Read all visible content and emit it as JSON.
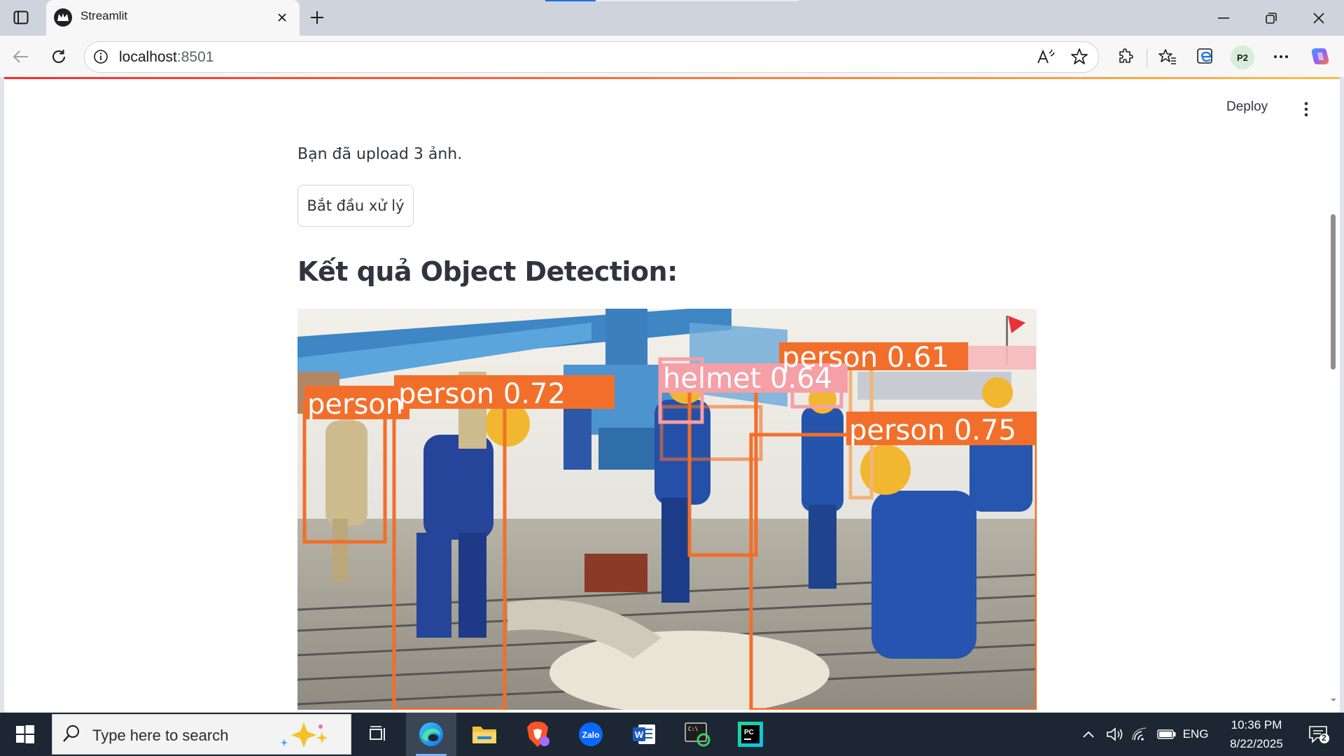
{
  "browser": {
    "tab_title": "Streamlit",
    "url_host": "localhost",
    "url_port": ":8501",
    "profile_label": "P2"
  },
  "app": {
    "deploy_label": "Deploy",
    "upload_info": "Bạn đã upload 3 ảnh.",
    "start_button": "Bắt đầu xử lý",
    "results_heading": "Kết quả Object Detection:",
    "detections": [
      {
        "label": "person",
        "score": "0.72",
        "text": "person 0.72"
      },
      {
        "label": "person",
        "score": "0.61",
        "text": "person 0.61"
      },
      {
        "label": "helmet",
        "score": "0.64",
        "text": "helmet 0.64"
      },
      {
        "label": "person",
        "score": "0.75",
        "text": "person 0.75"
      },
      {
        "label": "person",
        "score": "",
        "text": "person"
      }
    ],
    "colors": {
      "person_box": "#f26f2b",
      "helmet_box": "#f4a0a6",
      "accent_gradient_start": "#ff2b2b",
      "accent_gradient_end": "#ffbd45"
    }
  },
  "taskbar": {
    "search_placeholder": "Type here to search",
    "language": "ENG",
    "time": "10:36 PM",
    "date": "8/22/2025",
    "notification_count": "2",
    "apps": [
      "task-view",
      "edge",
      "file-explorer",
      "brave",
      "zalo",
      "word",
      "terminal",
      "pycharm"
    ]
  }
}
